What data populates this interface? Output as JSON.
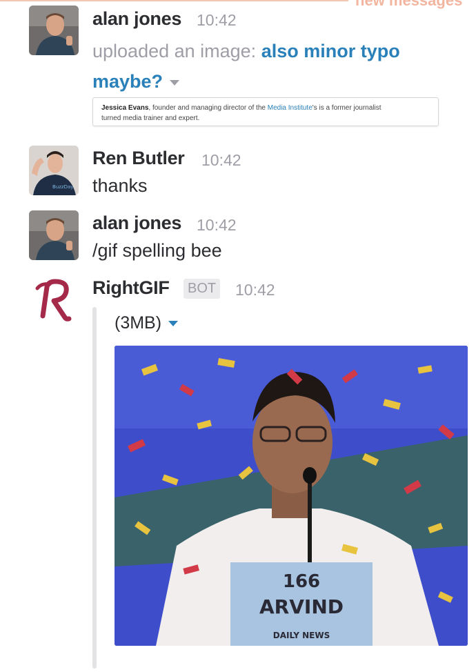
{
  "banner": {
    "label": "new messages"
  },
  "messages": [
    {
      "sender": "alan jones",
      "time": "10:42",
      "upload_prefix": "uploaded an image:",
      "upload_title": "also minor typo maybe?",
      "preview": {
        "name": "Jessica Evans",
        "text1": ", founder and managing director of the ",
        "org": "Media Institute",
        "text2": "'s is a former journalist",
        "line2": "turned media trainer and expert."
      }
    },
    {
      "sender": "Ren Butler",
      "time": "10:42",
      "text": "thanks"
    },
    {
      "sender": "alan jones",
      "time": "10:42",
      "text": "/gif spelling bee"
    },
    {
      "sender": "RightGIF",
      "badge": "BOT",
      "time": "10:42",
      "attachment_label": "(3MB)",
      "gif": {
        "placard_number": "166",
        "placard_name": "ARVIND",
        "placard_footer": "DAILY NEWS"
      }
    }
  ],
  "colors": {
    "link": "#2a80b9",
    "meta": "#9e9ea6",
    "text": "#2c2d30",
    "bot_logo": "#a52a4a"
  }
}
